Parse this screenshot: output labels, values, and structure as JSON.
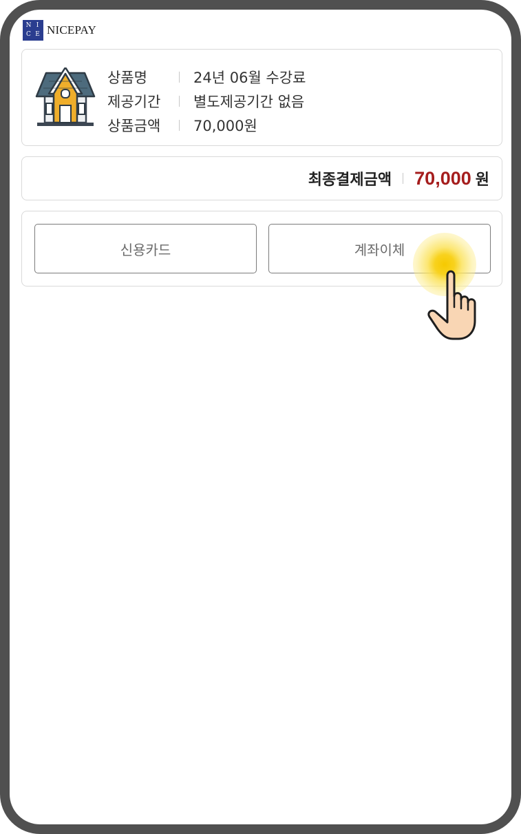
{
  "brand": {
    "logo_letters": [
      "N",
      "I",
      "C",
      "E"
    ],
    "name": "NICEPAY",
    "logo_color": "#2a3d8f"
  },
  "product": {
    "icon": "house-icon",
    "rows": [
      {
        "label": "상품명",
        "value": "24년 06월 수강료"
      },
      {
        "label": "제공기간",
        "value": "별도제공기간 없음"
      },
      {
        "label": "상품금액",
        "value": "70,000원"
      }
    ]
  },
  "total": {
    "label": "최종결제금액",
    "amount": "70,000",
    "unit": "원",
    "amount_color": "#a51d1d"
  },
  "payment_methods": {
    "credit_card": "신용카드",
    "bank_transfer": "계좌이체"
  },
  "cursor": {
    "icon": "hand-pointer-icon",
    "highlight_color": "#f6c900"
  }
}
